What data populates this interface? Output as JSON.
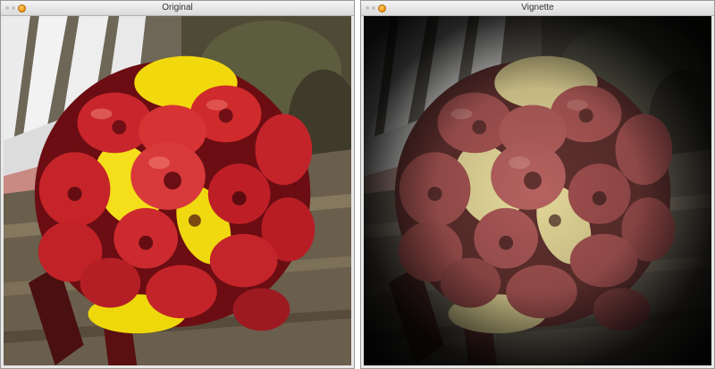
{
  "windows": [
    {
      "title": "Original",
      "image": "bouquet-of-red-and-yellow-calla-lilies-on-wooden-bench"
    },
    {
      "title": "Vignette",
      "image": "bouquet-photo-with-dark-vignette-effect"
    }
  ],
  "icons": {
    "minimize": "minimize-dot-icon",
    "zoom": "zoom-dot-icon",
    "close": "close-orange-icon"
  }
}
